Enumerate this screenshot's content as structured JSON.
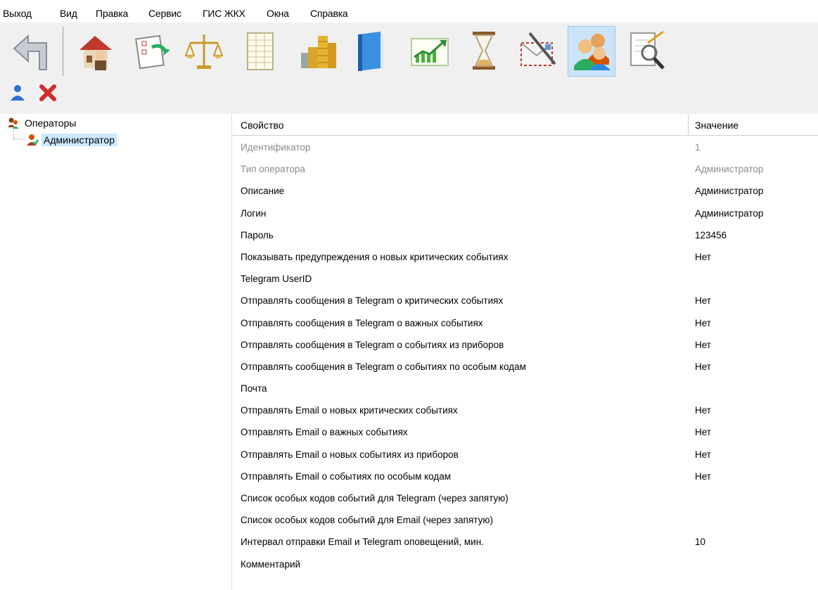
{
  "menu": [
    "Выход",
    "Вид",
    "Правка",
    "Сервис",
    "ГИС ЖКХ",
    "Окна",
    "Справка"
  ],
  "toolbar": {
    "buttons": [
      "back-icon",
      "home-user-icon",
      "documents-refresh-icon",
      "scales-icon",
      "spreadsheet-icon",
      "coins-icon",
      "book-icon",
      "chart-icon",
      "hourglass-icon",
      "mail-pen-icon",
      "users-icon",
      "document-search-icon"
    ],
    "active": "users-icon",
    "small_buttons": [
      "add-user-icon",
      "delete-icon"
    ]
  },
  "tree": {
    "root": "Операторы",
    "child": "Администратор"
  },
  "grid": {
    "header_property": "Свойство",
    "header_value": "Значение",
    "rows": [
      {
        "key": "Идентификатор",
        "value": "1",
        "disabled": true
      },
      {
        "key": "Тип оператора",
        "value": "Администратор",
        "disabled": true
      },
      {
        "key": "Описание",
        "value": "Администратор",
        "disabled": false
      },
      {
        "key": "Логин",
        "value": "Администратор",
        "disabled": false
      },
      {
        "key": "Пароль",
        "value": "123456",
        "disabled": false
      },
      {
        "key": "Показывать предупреждения о новых критических событиях",
        "value": "Нет",
        "disabled": false
      },
      {
        "key": "Telegram UserID",
        "value": "",
        "disabled": false
      },
      {
        "key": "Отправлять сообщения в Telegram о критических событиях",
        "value": "Нет",
        "disabled": false
      },
      {
        "key": "Отправлять сообщения в Telegram о важных событиях",
        "value": "Нет",
        "disabled": false
      },
      {
        "key": "Отправлять сообщения в Telegram о событиях из приборов",
        "value": "Нет",
        "disabled": false
      },
      {
        "key": "Отправлять сообщения в Telegram о событиях по особым кодам",
        "value": "Нет",
        "disabled": false
      },
      {
        "key": "Почта",
        "value": "",
        "disabled": false
      },
      {
        "key": "Отправлять Email о новых критических событиях",
        "value": "Нет",
        "disabled": false
      },
      {
        "key": "Отправлять Email о важных событиях",
        "value": "Нет",
        "disabled": false
      },
      {
        "key": "Отправлять Email о новых событиях из приборов",
        "value": "Нет",
        "disabled": false
      },
      {
        "key": "Отправлять Email о событиях по особым кодам",
        "value": "Нет",
        "disabled": false
      },
      {
        "key": "Список особых кодов событий для Telegram (через запятую)",
        "value": "",
        "disabled": false
      },
      {
        "key": "Список особых кодов событий для Email (через запятую)",
        "value": "",
        "disabled": false
      },
      {
        "key": "Интервал отправки Email и Telegram оповещений, мин.",
        "value": "10",
        "disabled": false
      },
      {
        "key": "Комментарий",
        "value": "",
        "disabled": false
      }
    ]
  }
}
